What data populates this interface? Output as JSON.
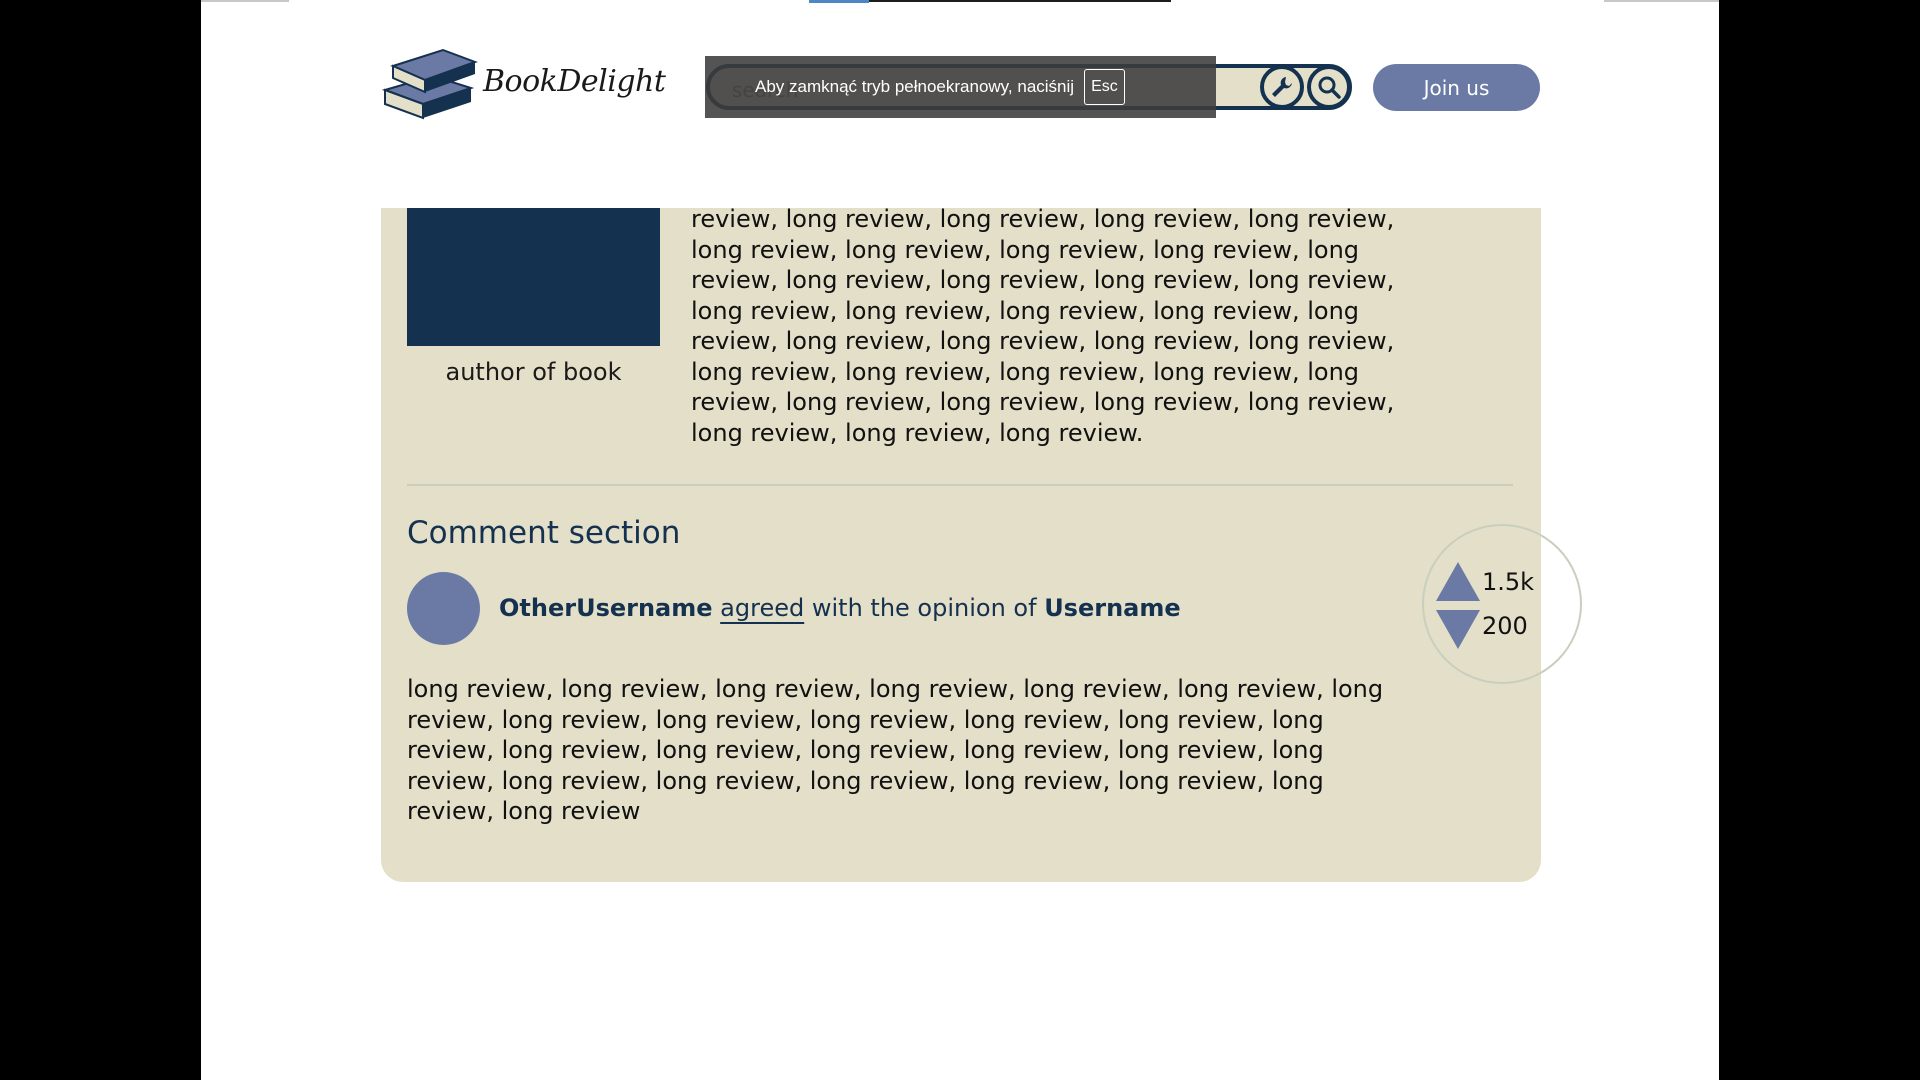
{
  "header": {
    "brand": "BookDelight",
    "search_placeholder": "search",
    "join_label": "Join us"
  },
  "fullscreen_notice": {
    "text": "Aby zamknąć tryb pełnoekranowy, naciśnij",
    "key": "Esc"
  },
  "book": {
    "author_label": "author of book",
    "review_text": "review, long review, long review, long review, long review, long review, long review, long review, long review, long review, long review, long review, long review, long review, long review, long review, long review, long review, long review, long review, long review, long review, long review, long review, long review, long review, long review, long review, long review, long review, long review, long review, long review, long review, long review."
  },
  "comments": {
    "title": "Comment section",
    "item": {
      "username": "OtherUsername",
      "action": "agreed",
      "connector": "with the opinion of",
      "target_user": "Username",
      "body": "long review, long review, long review, long review, long review, long review, long review, long review, long review, long review, long review, long review, long review, long review, long review, long review, long review, long review, long review, long review, long review, long review, long review, long review, long review, long review",
      "upvotes": "1.5k",
      "downvotes": "200"
    }
  },
  "colors": {
    "navy": "#14314f",
    "accent": "#6b7aa5",
    "card_bg": "#e4dfc8"
  }
}
